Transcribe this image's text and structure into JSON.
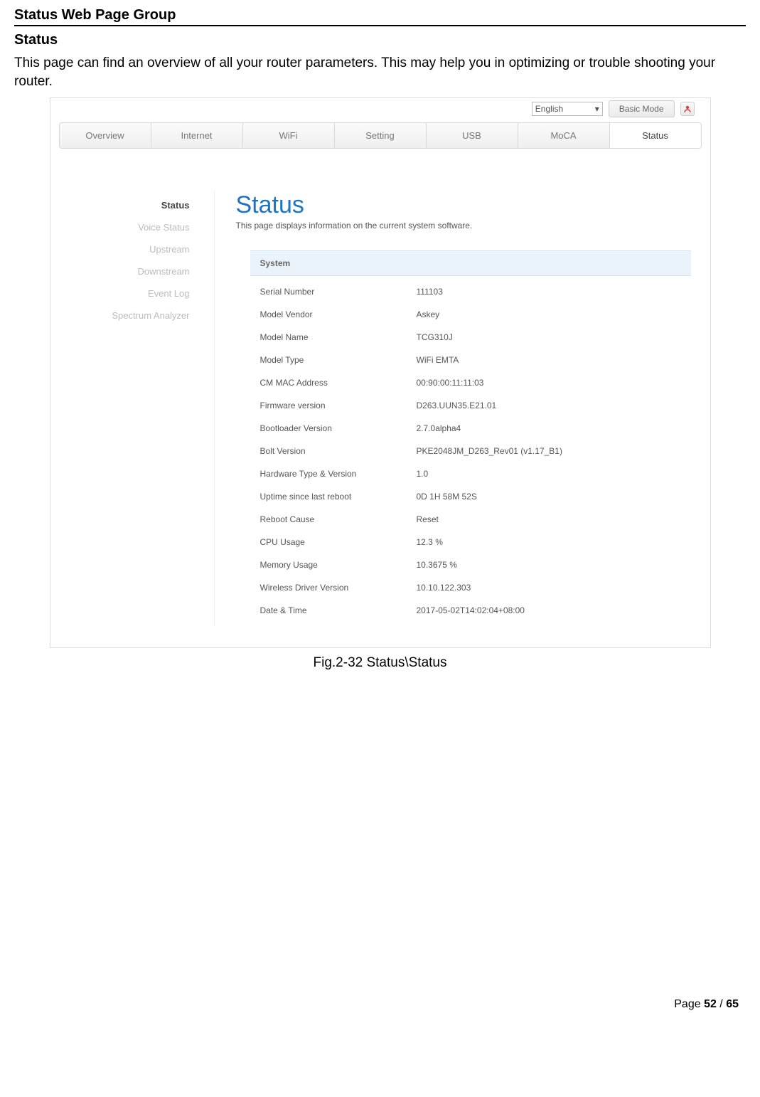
{
  "doc": {
    "section_title": "Status Web Page Group",
    "sub_title": "Status",
    "body_text": "This page can find an overview of all your router parameters. This may help you in optimizing or trouble shooting your router.",
    "fig_caption": "Fig.2-32 Status\\Status",
    "page_label_pre": "Page ",
    "page_current": "52",
    "page_sep": " / ",
    "page_total": "65"
  },
  "topbar": {
    "language": "English",
    "basic_mode": "Basic Mode"
  },
  "tabs": [
    {
      "label": "Overview"
    },
    {
      "label": "Internet"
    },
    {
      "label": "WiFi"
    },
    {
      "label": "Setting"
    },
    {
      "label": "USB"
    },
    {
      "label": "MoCA"
    },
    {
      "label": "Status"
    }
  ],
  "sidebar": [
    {
      "label": "Status",
      "active": true
    },
    {
      "label": "Voice Status"
    },
    {
      "label": "Upstream"
    },
    {
      "label": "Downstream"
    },
    {
      "label": "Event Log"
    },
    {
      "label": "Spectrum Analyzer"
    }
  ],
  "status_page": {
    "heading": "Status",
    "description": "This page displays information on the current system software.",
    "system_header": "System",
    "rows": [
      {
        "label": "Serial Number",
        "value": "111103"
      },
      {
        "label": "Model Vendor",
        "value": "Askey"
      },
      {
        "label": "Model Name",
        "value": "TCG310J"
      },
      {
        "label": "Model Type",
        "value": "WiFi EMTA"
      },
      {
        "label": "CM MAC Address",
        "value": "00:90:00:11:11:03"
      },
      {
        "label": "Firmware version",
        "value": "D263.UUN35.E21.01"
      },
      {
        "label": "Bootloader Version",
        "value": "2.7.0alpha4"
      },
      {
        "label": "Bolt Version",
        "value": "PKE2048JM_D263_Rev01 (v1.17_B1)"
      },
      {
        "label": "Hardware Type & Version",
        "value": "1.0"
      },
      {
        "label": "Uptime since last reboot",
        "value": "0D 1H 58M 52S"
      },
      {
        "label": "Reboot Cause",
        "value": "Reset"
      },
      {
        "label": "CPU Usage",
        "value": "12.3 %"
      },
      {
        "label": "Memory Usage",
        "value": "10.3675 %"
      },
      {
        "label": "Wireless Driver Version",
        "value": "10.10.122.303"
      },
      {
        "label": "Date & Time",
        "value": "2017-05-02T14:02:04+08:00"
      }
    ]
  }
}
